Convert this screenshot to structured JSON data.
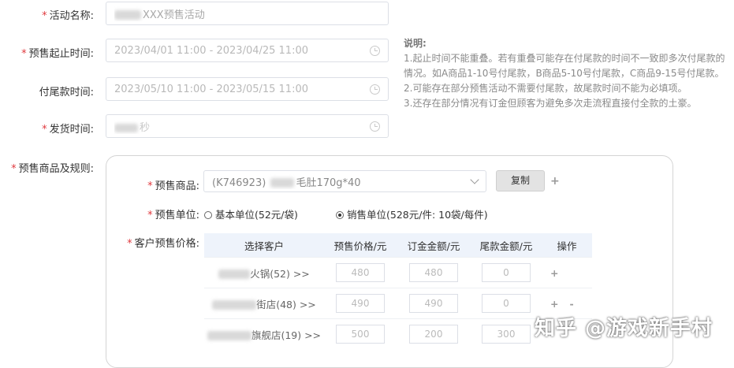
{
  "form": {
    "required_mark": "*",
    "activity_name": {
      "label": "活动名称:",
      "value": "XXX预售活动"
    },
    "presale_time": {
      "label": "预售起止时间:",
      "value": "2023/04/01 11:00 - 2023/04/25 11:00"
    },
    "final_payment_time": {
      "label": "付尾款时间:",
      "value": "2023/05/10 11:00 - 2023/05/15 11:00"
    },
    "delivery_time": {
      "label": "发货时间:",
      "value": "秒"
    },
    "goods_rules": {
      "label": "预售商品及规则:"
    }
  },
  "notes": {
    "title": "说明:",
    "lines": [
      "1.起止时间不能重叠。若有重叠可能存在付尾款的时间不一致即多次付尾款的",
      "情况。如A商品1-10号付尾款，B商品5-10号付尾款，C商品9-15号付尾款。",
      "2.可能存在部分预售活动不需要付尾款，故尾款时间不能为必填项。",
      "3.还存在部分情况有订金但顾客为避免多次走流程直接付全款的土豪。"
    ]
  },
  "panel": {
    "product": {
      "label": "预售商品:",
      "code": "(K746923)",
      "name": "毛肚170g*40"
    },
    "copy_button": "复制",
    "plus": "+",
    "minus": "-",
    "unit": {
      "label": "预售单位:",
      "options": [
        {
          "text": "基本单位(52元/袋)",
          "selected": false
        },
        {
          "text": "销售单位(528元/件: 10袋/每件)",
          "selected": true
        }
      ]
    },
    "price": {
      "label": "客户预售价格:",
      "columns": [
        "选择客户",
        "预售价格/元",
        "订金金额/元",
        "尾款金额/元",
        "操作"
      ],
      "rows": [
        {
          "customer": "火锅(52) >>",
          "presale": "480",
          "deposit": "480",
          "final": "0"
        },
        {
          "customer": "街店(48) >>",
          "presale": "490",
          "deposit": "490",
          "final": "0"
        },
        {
          "customer": "旗舰店(19) >>",
          "presale": "500",
          "deposit": "200",
          "final": "300"
        }
      ]
    }
  },
  "watermark": "知乎 @游戏新手村",
  "colors": {
    "required": "#e0393e",
    "table_header": "#eef3fb",
    "panel_border": "#d4d4d4"
  }
}
